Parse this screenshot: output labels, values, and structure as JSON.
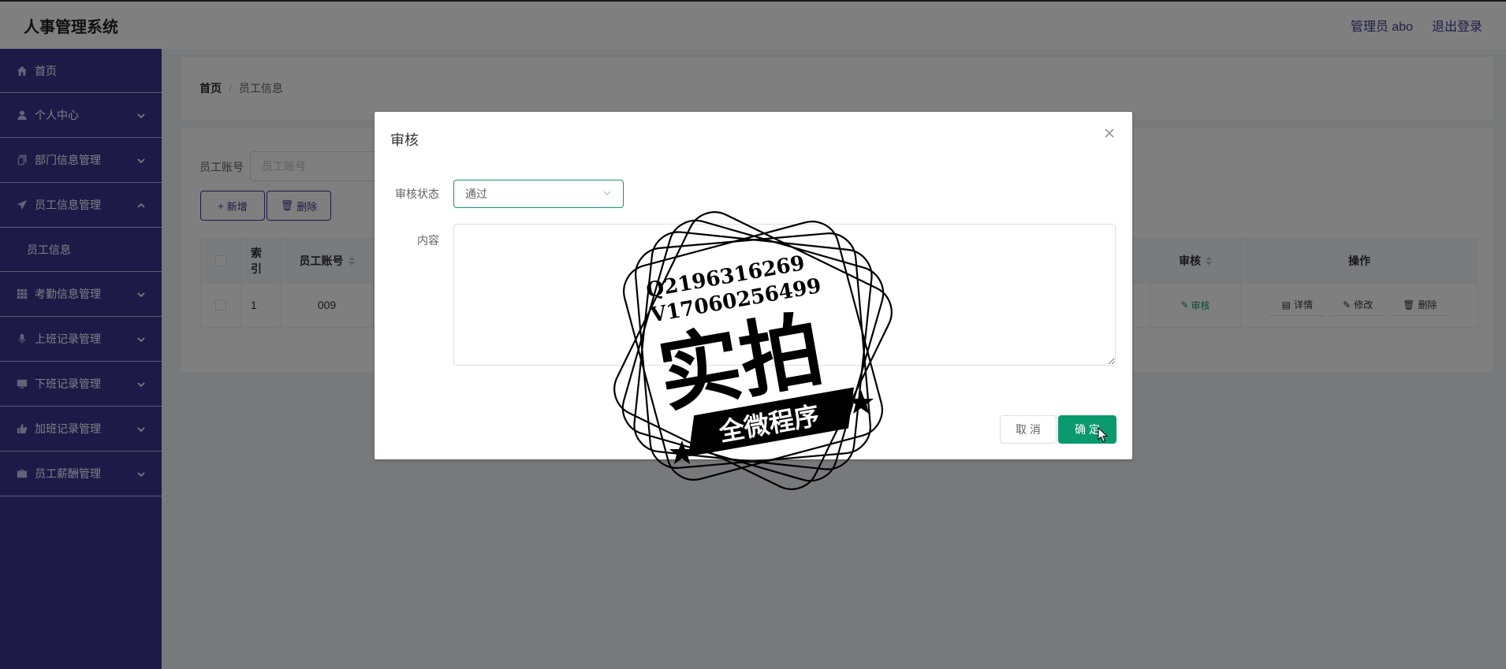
{
  "header": {
    "app_title": "人事管理系统",
    "admin_label": "管理员 abo",
    "logout_label": "退出登录"
  },
  "sidebar": {
    "items": [
      {
        "label": "首页",
        "icon": "home-icon"
      },
      {
        "label": "个人中心",
        "icon": "user-icon"
      },
      {
        "label": "部门信息管理",
        "icon": "copy-icon"
      },
      {
        "label": "员工信息管理",
        "icon": "send-icon",
        "expanded": true,
        "children": [
          {
            "label": "员工信息"
          }
        ]
      },
      {
        "label": "考勤信息管理",
        "icon": "grid-icon"
      },
      {
        "label": "上班记录管理",
        "icon": "mic-icon"
      },
      {
        "label": "下班记录管理",
        "icon": "monitor-icon"
      },
      {
        "label": "加班记录管理",
        "icon": "thumb-up-icon"
      },
      {
        "label": "员工薪酬管理",
        "icon": "briefcase-icon"
      }
    ]
  },
  "breadcrumb": {
    "home": "首页",
    "separator": "/",
    "current": "员工信息"
  },
  "search": {
    "label": "员工账号",
    "placeholder": "员工账号"
  },
  "toolbar": {
    "add_label": "新增",
    "delete_label": "删除"
  },
  "table": {
    "headers": {
      "index": "索引",
      "account": "员工账号",
      "audit": "审核",
      "operations": "操作"
    },
    "rows": [
      {
        "index": "1",
        "account": "009",
        "audit_action": "审核",
        "ops": {
          "detail": "详情",
          "edit": "修改",
          "delete": "删除"
        }
      }
    ]
  },
  "dialog": {
    "title": "审核",
    "status_label": "审核状态",
    "status_value": "通过",
    "content_label": "内容",
    "content_value": "",
    "cancel_label": "取 消",
    "confirm_label": "确 定"
  },
  "watermark": {
    "line1": "Q2196316269",
    "line2": "V17060256499",
    "big_text": "实拍",
    "banner_text": "全微程序"
  },
  "colors": {
    "sidebar_bg": "#3d3590",
    "accent_green": "#0a9a6f",
    "header_link": "#3f3a8e"
  }
}
